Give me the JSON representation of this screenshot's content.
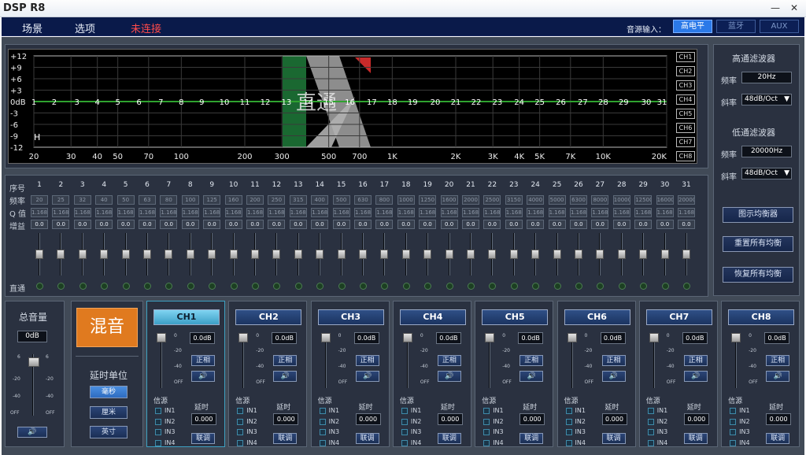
{
  "window": {
    "title": "DSP R8"
  },
  "menu": {
    "items": [
      "场景",
      "选项"
    ],
    "status": "未连接"
  },
  "source_input": {
    "label": "音源输入：",
    "options": [
      "高电平",
      "蓝牙",
      "AUX"
    ],
    "selected": "高电平"
  },
  "graph": {
    "y_ticks": [
      "+12",
      "+9",
      "+6",
      "+3",
      "0dB",
      "-3",
      "-6",
      "-9",
      "-12"
    ],
    "x_ticks": [
      "20",
      "30",
      "40",
      "50",
      "70",
      "100",
      "200",
      "300",
      "500",
      "700",
      "1K",
      "2K",
      "3K",
      "4K",
      "5K",
      "7K",
      "10K",
      "20K"
    ],
    "bands": [
      "1",
      "2",
      "3",
      "4",
      "5",
      "6",
      "7",
      "8",
      "9",
      "10",
      "11",
      "12",
      "13",
      "14",
      "15",
      "16",
      "17",
      "18",
      "19",
      "20",
      "21",
      "22",
      "23",
      "24",
      "25",
      "26",
      "27",
      "28",
      "29",
      "30",
      "31"
    ],
    "marker": "H",
    "watermark": "直通",
    "channel_buttons": [
      "CH1",
      "CH2",
      "CH3",
      "CH4",
      "CH5",
      "CH6",
      "CH7",
      "CH8"
    ],
    "curve_gain_db": 0
  },
  "eq_table": {
    "row_labels": [
      "序号",
      "频率",
      "Q 值",
      "增益",
      "直通"
    ],
    "freqs": [
      "20",
      "25",
      "32",
      "40",
      "50",
      "63",
      "80",
      "100",
      "125",
      "160",
      "200",
      "250",
      "315",
      "400",
      "500",
      "630",
      "800",
      "1000",
      "1250",
      "1600",
      "2000",
      "2500",
      "3150",
      "4000",
      "5000",
      "6300",
      "8000",
      "10000",
      "12500",
      "16000",
      "20000"
    ],
    "q": "1.168",
    "gain": "0.0"
  },
  "high_pass": {
    "title": "高通滤波器",
    "freq_label": "频率",
    "freq": "20Hz",
    "slope_label": "斜率",
    "slope": "48dB/Oct"
  },
  "low_pass": {
    "title": "低通滤波器",
    "freq_label": "频率",
    "freq": "20000Hz",
    "slope_label": "斜率",
    "slope": "48dB/Oct"
  },
  "side_buttons": [
    "图示均衡器",
    "重置所有均衡",
    "恢复所有均衡"
  ],
  "master": {
    "title": "总音量",
    "value": "0dB",
    "ticks_left": [
      "6",
      "-20",
      "-40",
      "OFF"
    ],
    "ticks_right": [
      "6",
      "-20",
      "-40",
      "OFF"
    ]
  },
  "mix": {
    "label": "混音",
    "delay_unit_label": "延时单位",
    "units": [
      "毫秒",
      "厘米",
      "英寸"
    ],
    "selected_unit": "毫秒"
  },
  "channels": {
    "names": [
      "CH1",
      "CH2",
      "CH3",
      "CH4",
      "CH5",
      "CH6",
      "CH7",
      "CH8"
    ],
    "selected": "CH1",
    "gain": "0.0dB",
    "phase_label": "正相",
    "source_label": "信源",
    "delay_label": "延时",
    "delay": "0.000",
    "link_label": "联调",
    "inputs": [
      "IN1",
      "IN2",
      "IN3",
      "IN4"
    ],
    "fader_ticks": [
      "0",
      "-20",
      "-40",
      "OFF"
    ]
  },
  "colors": {
    "curve": "#2fa22f",
    "menu_bg": "#0a1a4a",
    "selected": "#2b79e8",
    "mix": "#e07a1f"
  }
}
